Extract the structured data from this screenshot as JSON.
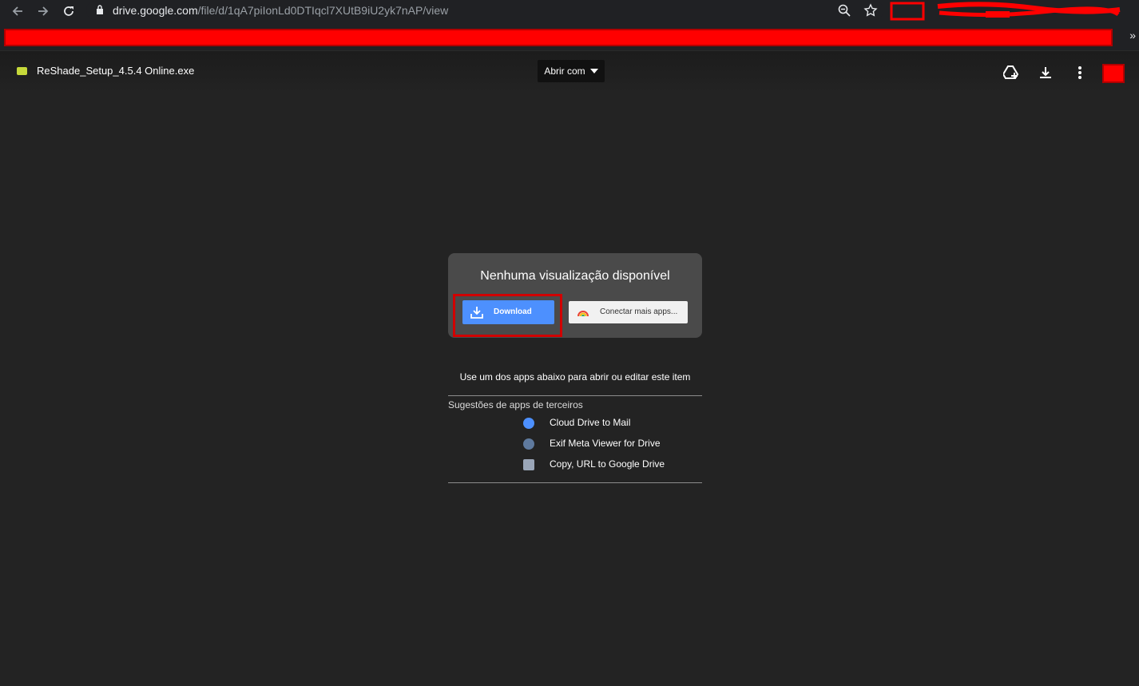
{
  "browser": {
    "url_host": "drive.google.com",
    "url_path": "/file/d/1qA7piIonLd0DTIqcl7XUtB9iU2yk7nAP/view",
    "more_bookmarks": "»"
  },
  "viewer": {
    "file_name": "ReShade_Setup_4.5.4 Online.exe",
    "open_with_label": "Abrir com"
  },
  "dialog": {
    "title": "Nenhuma visualização disponível",
    "download_label": "Download",
    "connect_label": "Conectar mais apps..."
  },
  "apps": {
    "hint": "Use um dos apps abaixo para abrir ou editar este item",
    "section_title": "Sugestões de apps de terceiros",
    "items": [
      {
        "label": "Cloud Drive to Mail",
        "icon": "mail-app-icon",
        "color": "#4d90fe"
      },
      {
        "label": "Exif Meta Viewer for Drive",
        "icon": "camera-app-icon",
        "color": "#5f7a9e"
      },
      {
        "label": "Copy, URL to Google Drive",
        "icon": "copy-url-app-icon",
        "color": "#9aa6b8"
      }
    ]
  },
  "colors": {
    "accent": "#4d90fe",
    "highlight": "#d10000",
    "redaction": "#ff0000"
  }
}
